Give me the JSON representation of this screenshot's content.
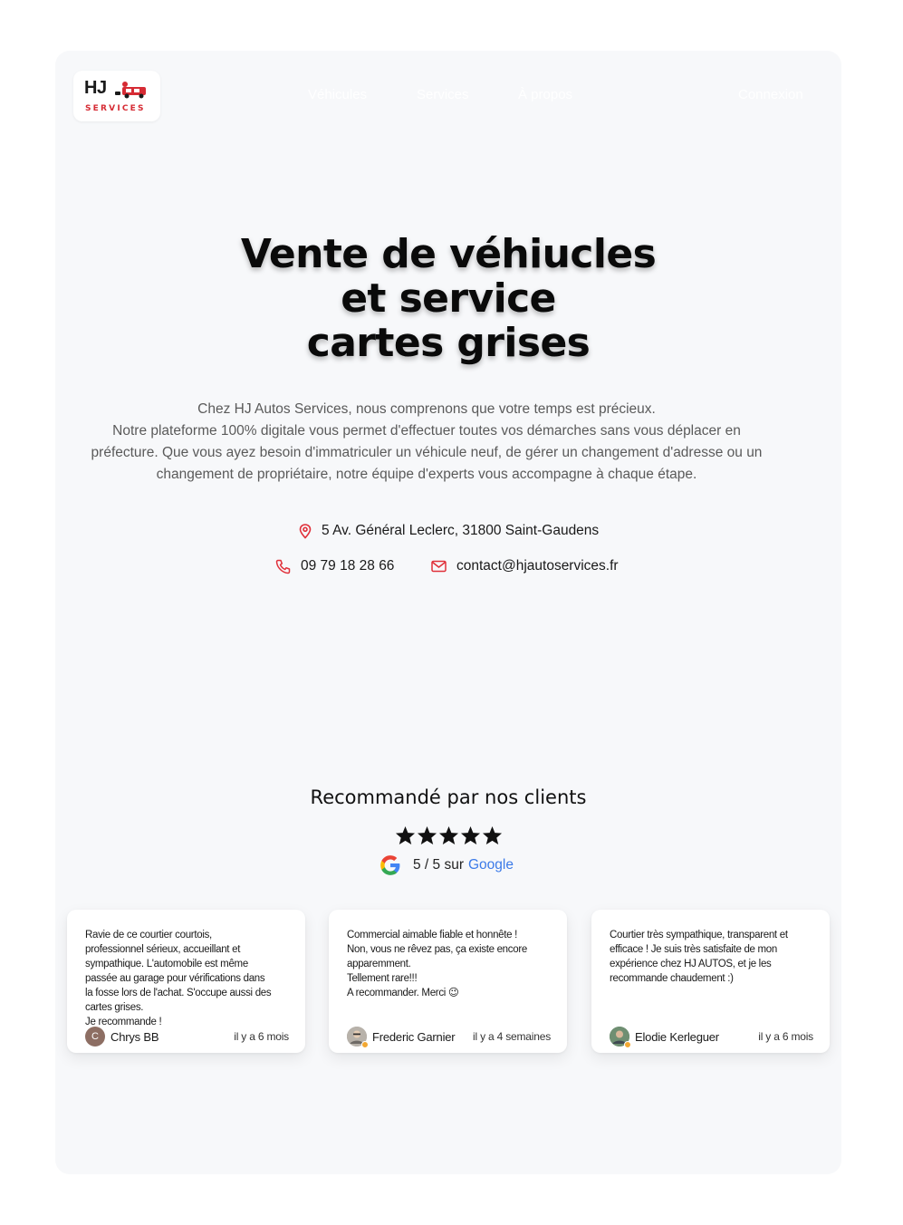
{
  "logo": {
    "brand": "HJ",
    "subtitle": "SERVICES",
    "car_icon": "car-icon"
  },
  "nav": {
    "links": [
      "Véhicules",
      "Services",
      "À propos"
    ],
    "login": "Connexion"
  },
  "hero": {
    "title_lines": [
      "Vente de véhiucles",
      "et service",
      "cartes grises"
    ],
    "paragraph_lines": [
      "Chez HJ Autos Services, nous comprenons que votre temps est précieux.",
      "Notre plateforme 100% digitale vous permet d'effectuer toutes vos démarches sans vous déplacer en",
      "préfecture. Que vous ayez besoin d'immatriculer un véhicule neuf, de gérer un changement d'adresse ou un",
      "changement de propriétaire, notre équipe d'experts vous accompagne à chaque étape."
    ]
  },
  "contact": {
    "address": "5 Av. Général Leclerc, 31800 Saint-Gaudens",
    "phone": "09 79 18 28 66",
    "email": "contact@hjautoservices.fr",
    "icons": {
      "address": "map-pin-icon",
      "phone": "phone-icon",
      "email": "mail-icon"
    },
    "accent_color": "#e0303a"
  },
  "reviews": {
    "title": "Recommandé par nos clients",
    "rating_stars": 5,
    "rating_text": "5 / 5 sur",
    "rating_source": "Google",
    "items": [
      {
        "lines": [
          "Ravie de ce courtier courtois,",
          "professionnel sérieux, accueillant et",
          "sympathique. L'automobile est même",
          "passée au garage pour vérifications dans",
          "la fosse lors de l'achat. S'occupe aussi des",
          "cartes grises.",
          "Je recommande !"
        ],
        "author": "Chrys BB",
        "avatar_initial": "C",
        "avatar_color": "#8d6e63",
        "time": "il y a 6 mois"
      },
      {
        "lines": [
          "Commercial aimable fiable et honnête !",
          "Non, vous ne rêvez pas, ça existe encore",
          "apparemment.",
          "Tellement rare!!!",
          "A recommander. Merci 😉"
        ],
        "author": "Frederic Garnier",
        "avatar_initial": "",
        "avatar_color": "#9a9a9a",
        "time": "il y a 4 semaines"
      },
      {
        "lines": [
          "Courtier très sympathique, transparent et",
          "efficace ! Je suis très satisfaite de mon",
          "expérience chez HJ AUTOS, et je les",
          "recommande chaudement :)"
        ],
        "author": "Elodie Kerleguer",
        "avatar_initial": "",
        "avatar_color": "#5a7a5f",
        "time": "il y a 6 mois"
      }
    ]
  }
}
